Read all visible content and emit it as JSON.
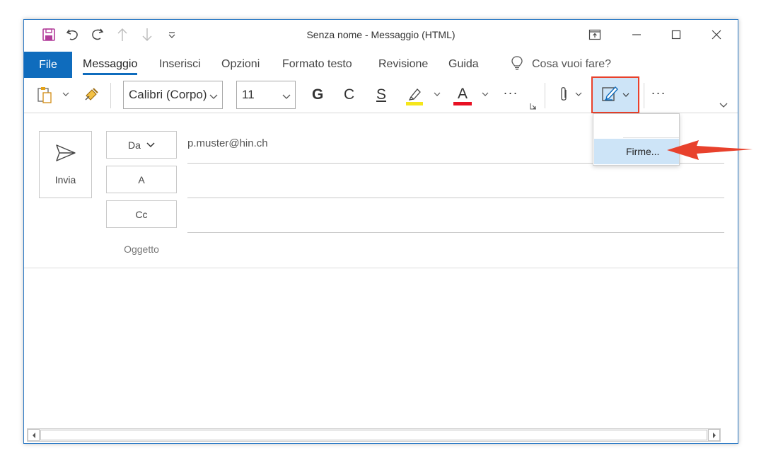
{
  "window": {
    "title": "Senza nome  -  Messaggio (HTML)"
  },
  "quick_access": [
    "save-icon",
    "undo-icon",
    "redo-icon",
    "up-arrow-icon",
    "down-arrow-icon",
    "customize-icon"
  ],
  "tabs": {
    "file": "File",
    "items": [
      "Messaggio",
      "Inserisci",
      "Opzioni",
      "Formato testo",
      "Revisione",
      "Guida"
    ],
    "active": "Messaggio",
    "tell_me": "Cosa vuoi fare?"
  },
  "ribbon": {
    "font_name": "Calibri (Corpo)",
    "font_size": "11",
    "bold": "G",
    "italic": "C",
    "underline": "S",
    "font_color_letter": "A",
    "more": "···",
    "highlight_color": "#f5e61b",
    "font_color": "#e81123"
  },
  "compose": {
    "send_label": "Invia",
    "from_button": "Da",
    "from_value": "p.muster@hin.ch",
    "to_button": "A",
    "cc_button": "Cc",
    "subject_label": "Oggetto"
  },
  "signature_menu": {
    "item": "Firme..."
  },
  "colors": {
    "accent": "#0f6cbd",
    "highlight_box": "#e8412c",
    "arrow": "#e8412c"
  }
}
